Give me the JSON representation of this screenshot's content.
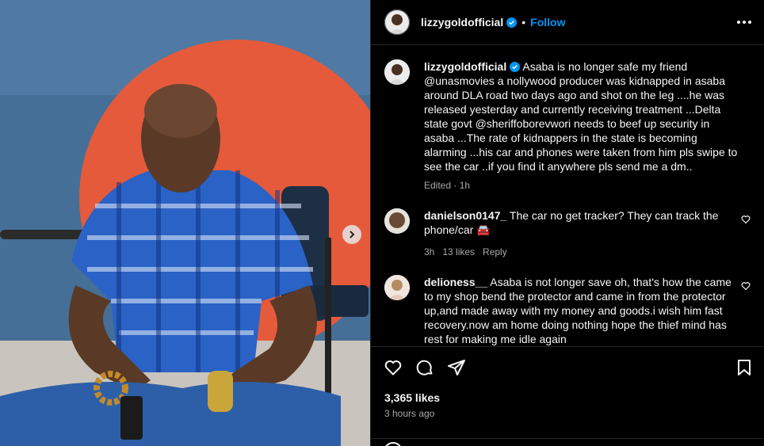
{
  "post": {
    "username": "lizzygoldofficial",
    "follow_label": "Follow",
    "dot": "•"
  },
  "caption": {
    "username": "lizzygoldofficial",
    "text": "Asaba is no longer safe my friend @unasmovies a nollywood producer was kidnapped in asaba around DLA road two days ago and shot on the leg ....he was released yesterday and currently receiving treatment ...Delta state govt @sheriffoborevwori needs to beef up security in asaba ...The rate of kidnappers in the state is becoming alarming ...his car and phones were taken from him pls swipe to see the car ..if you find it anywhere pls send me a dm..",
    "meta": "Edited · 1h"
  },
  "comments": [
    {
      "username": "danielson0147_",
      "text": "The car no get tracker? They can track the phone/car 🚘",
      "time": "3h",
      "likes": "13 likes",
      "reply": "Reply"
    },
    {
      "username": "delioness__",
      "text": "Asaba is not longer save oh, that's how the came to my shop bend the protector and came in from the protector up,and made away with my money and goods.i wish him fast recovery.now am home doing nothing hope the thief mind has rest for making me idle again",
      "time": "",
      "likes": "",
      "reply": ""
    }
  ],
  "footer": {
    "likes": "3,365 likes",
    "time": "3 hours ago"
  },
  "colors": {
    "accent": "#0095f6",
    "background": "#000000",
    "muted": "#a8a8a8"
  },
  "icons": [
    "verified-icon",
    "more-icon",
    "next-arrow-icon",
    "heart-icon",
    "comment-icon",
    "share-icon",
    "save-icon",
    "emoji-icon"
  ]
}
